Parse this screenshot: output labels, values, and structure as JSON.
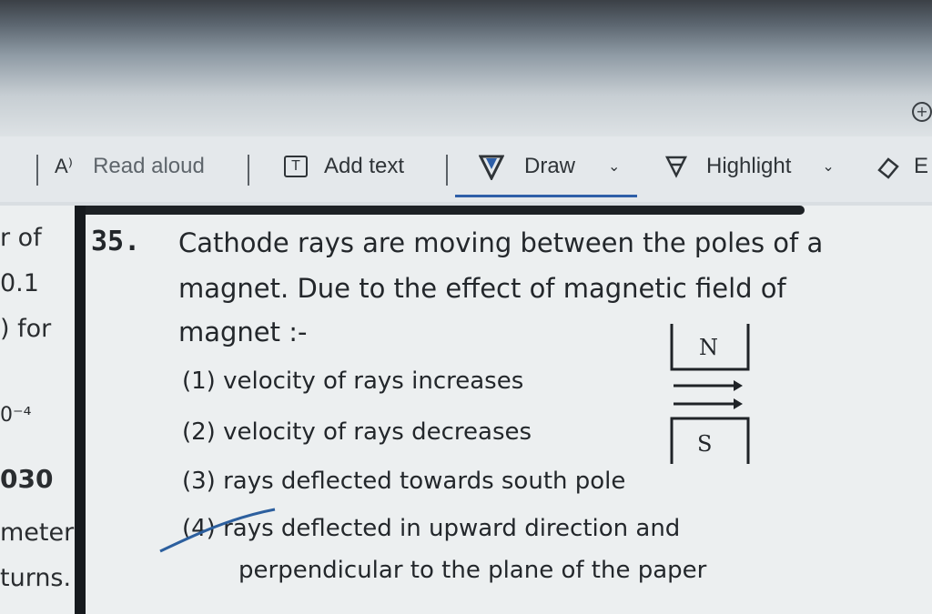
{
  "toolbar": {
    "read_aloud_label": "Read aloud",
    "add_text_label": "Add text",
    "draw_label": "Draw",
    "highlight_label": "Highlight",
    "read_aloud_icon_glyph": "A⁾",
    "add_text_icon_glyph": "T",
    "truncated_item": "E"
  },
  "margin": {
    "lines": [
      "r of",
      "0.1",
      ") for",
      "0⁻⁴",
      "030",
      "meter",
      "turns."
    ]
  },
  "question": {
    "number": "35.",
    "text_lines": [
      "Cathode rays are moving between the poles of a",
      "magnet. Due to the effect of magnetic field of",
      "magnet :-"
    ],
    "options": [
      "(1) velocity of rays increases",
      "(2) velocity of rays decreases",
      "(3) rays deflected towards south pole",
      "(4) rays deflected in upward direction and",
      "perpendicular to the plane of the paper"
    ],
    "diagram": {
      "north_label": "N",
      "south_label": "S"
    }
  },
  "colors": {
    "accent": "#2e5fa8",
    "pen_mark": "#2c5f9e"
  }
}
